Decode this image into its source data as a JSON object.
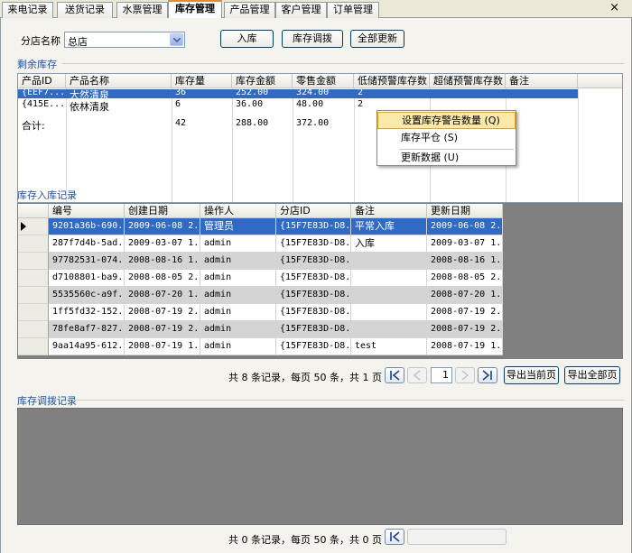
{
  "tabs": [
    "来电记录",
    "送货记录",
    "水票管理",
    "库存管理",
    "产品管理",
    "客户管理",
    "订单管理"
  ],
  "active_tab": 3,
  "close_glyph": "×",
  "toolbar": {
    "branch_label": "分店名称",
    "branch_value": "总店",
    "in_button": "入库",
    "transfer_button": "库存调拨",
    "refresh_button": "全部更新"
  },
  "stock": {
    "title": "剩余库存",
    "columns": [
      "产品ID",
      "产品名称",
      "库存量",
      "库存金额",
      "零售金额",
      "低储预警库存数",
      "超储预警库存数",
      "备注"
    ],
    "rows": [
      [
        "{EEF7...",
        "大然清泉",
        "36",
        "252.00",
        "324.00",
        "2",
        "",
        ""
      ],
      [
        "{415E...",
        "依林清泉",
        "6",
        "36.00",
        "48.00",
        "2",
        "",
        ""
      ]
    ],
    "total": [
      "合计:",
      "",
      "42",
      "288.00",
      "372.00",
      "",
      "",
      ""
    ]
  },
  "context_menu": {
    "items": [
      "设置库存警告数量 (Q)",
      "库存平仓 (S)",
      "更新数据 (U)"
    ]
  },
  "records": {
    "title": "库存入库记录",
    "columns": [
      "编号",
      "创建日期",
      "操作人",
      "分店ID",
      "备注",
      "更新日期"
    ],
    "rows": [
      [
        "9201a36b-690...",
        "2009-06-08 2...",
        "管理员",
        "{15F7E83D-D8...",
        "平常入库",
        "2009-06-08 2..."
      ],
      [
        "287f7d4b-5ad...",
        "2009-03-07 1...",
        "admin",
        "{15F7E83D-D8...",
        "入库",
        "2009-03-07 1..."
      ],
      [
        "97782531-074...",
        "2008-08-16 1...",
        "admin",
        "{15F7E83D-D8...",
        "",
        "2008-08-16 1..."
      ],
      [
        "d7108801-ba9...",
        "2008-08-05 2...",
        "admin",
        "{15F7E83D-D8...",
        "",
        "2008-08-05 2..."
      ],
      [
        "5535560c-a9f...",
        "2008-07-20 1...",
        "admin",
        "{15F7E83D-D8...",
        "",
        "2008-07-20 1..."
      ],
      [
        "1ff5fd32-152...",
        "2008-07-19 2...",
        "admin",
        "{15F7E83D-D8...",
        "",
        "2008-07-19 2..."
      ],
      [
        "78fe8af7-827...",
        "2008-07-19 2...",
        "admin",
        "{15F7E83D-D8...",
        "",
        "2008-07-19 2..."
      ],
      [
        "9aa14a95-612...",
        "2008-07-19 1...",
        "admin",
        "{15F7E83D-D8...",
        "test",
        "2008-07-19 1..."
      ]
    ],
    "pager_text": "共 8 条记录，每页 50 条，共 1 页",
    "page": "1",
    "export_current": "导出当前页",
    "export_all": "导出全部页"
  },
  "transfer": {
    "title": "库存调拨记录",
    "pager_text": "共 0 条记录，每页 50 条，共 0 页"
  },
  "colors": {
    "selected_row": "#316ac5",
    "grid_dark": "#808080",
    "row_alt": "#d4d4d4"
  }
}
